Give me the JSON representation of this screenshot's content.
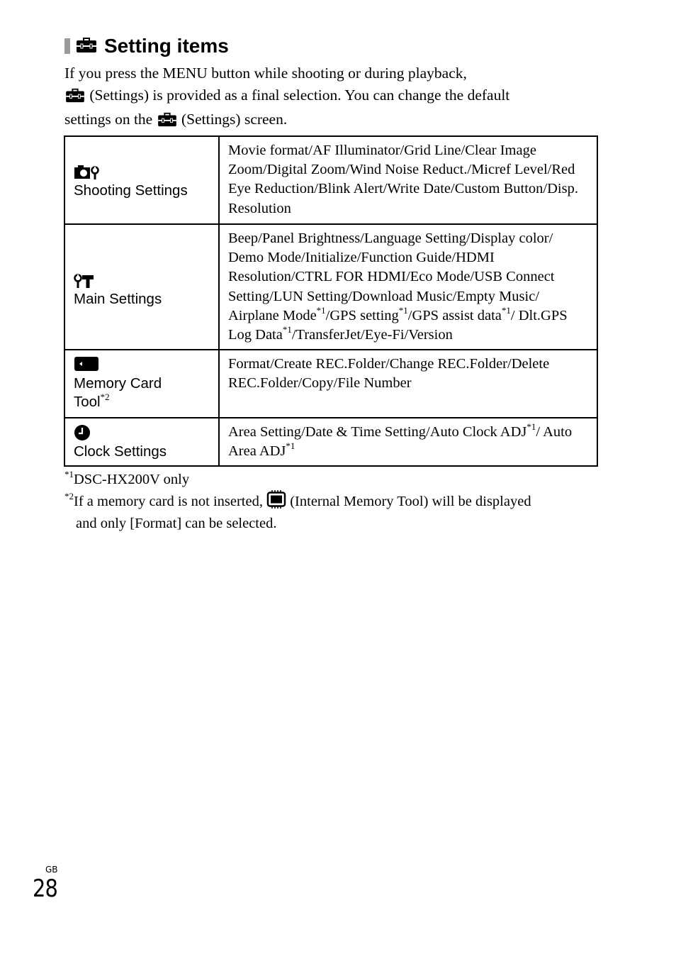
{
  "section": {
    "title": "Setting items",
    "icon": "toolbox-icon"
  },
  "intro": {
    "line1": "If you press the MENU button while shooting or during playback,",
    "line2": "(Settings) is provided as a final selection. You can change the default",
    "line3_pre": "settings on the",
    "line3_post": "(Settings) screen."
  },
  "table": {
    "rows": [
      {
        "icon": "camera-wrench-icon",
        "category": "Shooting Settings",
        "items": "Movie format/AF Illuminator/Grid Line/Clear Image Zoom/Digital Zoom/Wind Noise Reduct./Micref Level/Red Eye Reduction/Blink Alert/Write Date/Custom Button/Disp. Resolution"
      },
      {
        "icon": "wrench-hammer-icon",
        "category": "Main Settings",
        "items_parts": [
          "Beep/Panel Brightness/Language Setting/Display color/ Demo Mode/Initialize/Function Guide/HDMI Resolution/CTRL FOR HDMI/Eco Mode/USB Connect Setting/LUN Setting/Download Music/Empty Music/ Airplane Mode",
          "*1",
          "/GPS setting",
          "*1",
          "/GPS assist data",
          "*1",
          "/ Dlt.GPS Log Data",
          "*1",
          "/TransferJet/Eye-Fi/Version"
        ]
      },
      {
        "icon": "memory-card-icon",
        "category_line1": "Memory Card",
        "category_line2": "Tool",
        "category_note": "*2",
        "items": "Format/Create REC.Folder/Change REC.Folder/Delete REC.Folder/Copy/File Number"
      },
      {
        "icon": "clock-icon",
        "category": "Clock Settings",
        "items_parts": [
          "Area Setting/Date & Time Setting/Auto Clock ADJ",
          "*1",
          "/ Auto Area ADJ",
          "*1"
        ]
      }
    ]
  },
  "footnotes": {
    "fn1_mark": "*1",
    "fn1_text": "DSC-HX200V only",
    "fn2_mark": "*2",
    "fn2_text_pre": "If a memory card is not inserted,",
    "fn2_text_post": "(Internal Memory Tool) will be displayed",
    "fn2_text_cont": "and only [Format] can be selected."
  },
  "page": {
    "region": "GB",
    "number": "28"
  }
}
